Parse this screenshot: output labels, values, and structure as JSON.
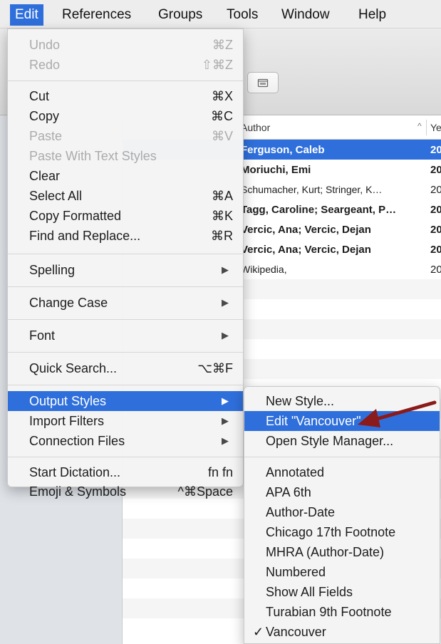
{
  "menubar": {
    "items": [
      {
        "label": "Edit",
        "active": true
      },
      {
        "label": "References"
      },
      {
        "label": "Groups"
      },
      {
        "label": "Tools"
      },
      {
        "label": "Window"
      },
      {
        "label": "Help"
      }
    ]
  },
  "library": {
    "columns": {
      "author": "Author",
      "year": "Ye"
    },
    "rows": [
      {
        "author": "Ferguson, Caleb",
        "year": "20"
      },
      {
        "author": "Moriuchi, Emi",
        "year": "20"
      },
      {
        "author": "Schumacher, Kurt; Stringer, K…",
        "year": "20"
      },
      {
        "author": "Tagg, Caroline; Seargeant, P…",
        "year": "20"
      },
      {
        "author": "Vercic, Ana; Vercic, Dejan",
        "year": "20"
      },
      {
        "author": "Vercic, Ana; Vercic, Dejan",
        "year": "20"
      },
      {
        "author": "Wikipedia,",
        "year": "20"
      }
    ]
  },
  "edit_menu": {
    "items": [
      {
        "label": "Undo",
        "shortcut": "⌘Z"
      },
      {
        "label": "Redo",
        "shortcut": "⇧⌘Z"
      },
      {
        "label": "Cut",
        "shortcut": "⌘X"
      },
      {
        "label": "Copy",
        "shortcut": "⌘C"
      },
      {
        "label": "Paste",
        "shortcut": "⌘V"
      },
      {
        "label": "Paste With Text Styles"
      },
      {
        "label": "Clear"
      },
      {
        "label": "Select All",
        "shortcut": "⌘A"
      },
      {
        "label": "Copy Formatted",
        "shortcut": "⌘K"
      },
      {
        "label": "Find and Replace...",
        "shortcut": "⌘R"
      },
      {
        "label": "Spelling"
      },
      {
        "label": "Change Case"
      },
      {
        "label": "Font"
      },
      {
        "label": "Quick Search...",
        "shortcut": "⌥⌘F"
      },
      {
        "label": "Output Styles"
      },
      {
        "label": "Import Filters"
      },
      {
        "label": "Connection Files"
      },
      {
        "label": "Start Dictation...",
        "shortcut": "fn fn"
      },
      {
        "label": "Emoji & Symbols",
        "shortcut": "^⌘Space"
      }
    ]
  },
  "output_styles_menu": {
    "items": [
      {
        "label": "New Style..."
      },
      {
        "label": "Edit \"Vancouver\""
      },
      {
        "label": "Open Style Manager..."
      },
      {
        "label": "Annotated"
      },
      {
        "label": "APA 6th"
      },
      {
        "label": "Author-Date"
      },
      {
        "label": "Chicago 17th Footnote"
      },
      {
        "label": "MHRA (Author-Date)"
      },
      {
        "label": "Numbered"
      },
      {
        "label": "Show All Fields"
      },
      {
        "label": "Turabian 9th Footnote"
      },
      {
        "label": "Vancouver",
        "checkmark": "✓"
      }
    ]
  },
  "colors": {
    "accent": "#2f6fdb",
    "annotation_arrow": "#8b1a1a"
  },
  "icons": {
    "toolbar_button": "folder-icon",
    "submenu_arrow": "chevron-right-icon",
    "checkmark": "checkmark-icon"
  }
}
